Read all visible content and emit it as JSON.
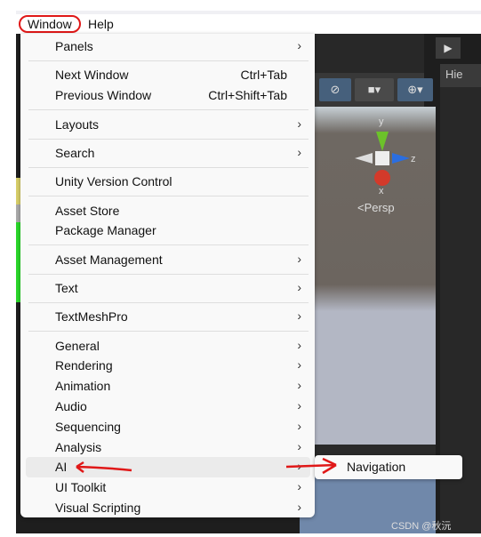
{
  "menubar": {
    "items": [
      "Window",
      "Help"
    ]
  },
  "menu": {
    "items": [
      {
        "label": "Panels",
        "submenu": true,
        "top": 0
      },
      {
        "sep": true
      },
      {
        "label": "Next Window",
        "shortcut": "Ctrl+Tab"
      },
      {
        "label": "Previous Window",
        "shortcut": "Ctrl+Shift+Tab"
      },
      {
        "sep": true
      },
      {
        "label": "Layouts",
        "submenu": true
      },
      {
        "sep": true
      },
      {
        "label": "Search",
        "submenu": true
      },
      {
        "sep": true
      },
      {
        "label": "Unity Version Control"
      },
      {
        "sep": true
      },
      {
        "label": "Asset Store"
      },
      {
        "label": "Package Manager"
      },
      {
        "sep": true
      },
      {
        "label": "Asset Management",
        "submenu": true
      },
      {
        "sep": true
      },
      {
        "label": "Text",
        "submenu": true
      },
      {
        "sep": true
      },
      {
        "label": "TextMeshPro",
        "submenu": true
      },
      {
        "sep": true
      },
      {
        "label": "General",
        "submenu": true
      },
      {
        "label": "Rendering",
        "submenu": true
      },
      {
        "label": "Animation",
        "submenu": true
      },
      {
        "label": "Audio",
        "submenu": true
      },
      {
        "label": "Sequencing",
        "submenu": true
      },
      {
        "label": "Analysis",
        "submenu": true
      },
      {
        "label": "AI",
        "submenu": true,
        "highlighted": true
      },
      {
        "label": "UI Toolkit",
        "submenu": true
      },
      {
        "label": "Visual Scripting",
        "submenu": true
      }
    ]
  },
  "submenu": {
    "label": "Navigation"
  },
  "scene": {
    "persp": "<Persp",
    "axes": [
      "y",
      "z",
      "x"
    ]
  },
  "hierarchy": {
    "title": "Hie"
  },
  "watermark": "CSDN @秋沅",
  "colors": {
    "annotation": "#e01818",
    "menu_bg": "#f9f9f9"
  }
}
